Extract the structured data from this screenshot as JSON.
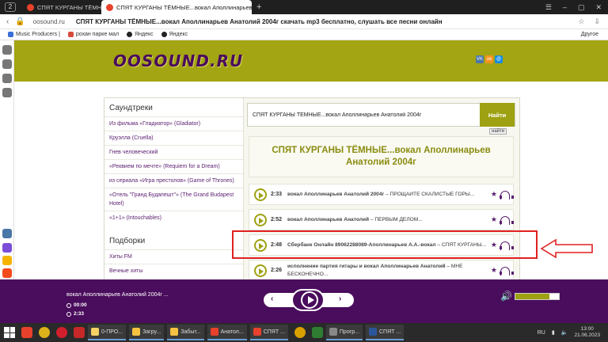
{
  "browser": {
    "tab_count": "2",
    "tabs": [
      {
        "label": "СПЯТ КУРГАНЫ ТЁМНЫ",
        "favicon_color": "#e8412c"
      },
      {
        "label": "СПЯТ КУРГАНЫ ТЁМНЫЕ...вокал Аполлинарьев Анатолий",
        "favicon_color": "#e8412c"
      }
    ],
    "url_domain": "oosound.ru",
    "url_title": "СПЯТ КУРГАНЫ ТЁМНЫЕ...вокал Аполлинарьев Анатолий 2004г скачать mp3 бесплатно, слушать все песни онлайн",
    "bookmarks": [
      {
        "label": "Music Producers |",
        "color": "#3a6fd8"
      },
      {
        "label": "рохан парке мал",
        "color": "#d84a3a"
      },
      {
        "label": "Яндекс",
        "color": "#222222"
      },
      {
        "label": "Яндекс",
        "color": "#222222"
      }
    ],
    "bookmarks_other": "Другое"
  },
  "site": {
    "logo": "OOSOUND.RU",
    "socials": [
      {
        "icon": "vk-icon",
        "label": "VK",
        "color": "#4a76a8"
      },
      {
        "icon": "odnoklassniki-icon",
        "label": "ок",
        "color": "#f7931e"
      },
      {
        "icon": "moimir-icon",
        "label": "@",
        "color": "#168de2"
      }
    ],
    "accent": "#9ea111",
    "brand_purple": "#4a0c5c"
  },
  "sidebar": {
    "section1_title": "Саундтреки",
    "section1_items": [
      "Из фильма «Гладиатор» (Gladiator)",
      "Круэлла (Cruella)",
      "Гнев человеческий",
      "«Реквием по мечте» (Requiem for a Dream)",
      "из сериала «Игра престолов» (Game of Thrones)",
      "«Отель \"Гранд Будапешт\"» (The Grand Budapest Hotel)",
      "«1+1» (Intouchables)"
    ],
    "section2_title": "Подборки",
    "section2_items": [
      "Хиты FM",
      "Вечные хиты"
    ]
  },
  "search": {
    "value": "СПЯТ КУРГАНЫ ТЁМНЫЕ...вокал Аполлинарьев Анатолий 2004г",
    "button": "Найти",
    "tooltip": "найти"
  },
  "heading": "СПЯТ КУРГАНЫ ТЁМНЫЕ...вокал Аполлинарьев Анатолий 2004г",
  "tracks": [
    {
      "duration": "2:33",
      "artist": "вокал Аполлинарьев Анатолий 2004г",
      "title": " – ПРОЩАЙТЕ СКАЛИСТЫЕ ГОРЫ..."
    },
    {
      "duration": "2:52",
      "artist": "вокал Аполлинарьев Анатолий",
      "title": " – ПЕРВЫМ ДЕЛОМ..."
    },
    {
      "duration": "2:48",
      "artist": "Сбербанк Онлайн 89062288089-Аполлинарьев А.А.-вокал",
      "title": " – СПЯТ КУРГАНЫ..."
    },
    {
      "duration": "2:26",
      "artist": "исполнение партия гитары и вокал Аполлинарьев Анатолий",
      "title": " – МНЕ БЕСКОНЕЧНО..."
    }
  ],
  "player": {
    "now_playing": "вокал Аполлинарьев Анатолий 2004г ...",
    "elapsed": "00:00",
    "total": "2:33",
    "volume": 0.78
  },
  "taskbar": {
    "items": [
      "0-ПРО...",
      "Загру...",
      "Забыт...",
      "Анатол...",
      "СПЯТ ...",
      "Прогр...",
      "СПЯТ ..."
    ],
    "lang": "RU",
    "time": "13:00",
    "date": "21.06.2023"
  }
}
